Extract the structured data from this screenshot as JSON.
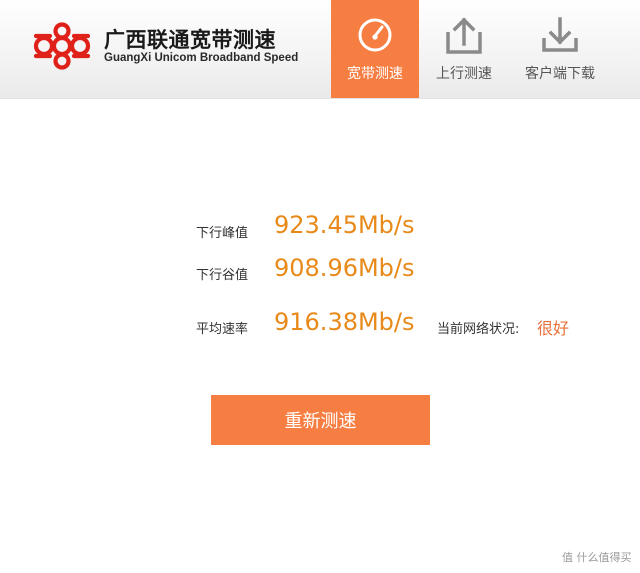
{
  "brand": {
    "name_cn": "广西联通宽带测速",
    "name_en": "GuangXi Unicom Broadband Speed",
    "logo_icon": "china-unicom-knot-icon",
    "logo_color": "#e0211a"
  },
  "nav": {
    "tabs": [
      {
        "label": "宽带测速",
        "icon": "speedometer-icon",
        "active": true
      },
      {
        "label": "上行测速",
        "icon": "upload-icon",
        "active": false
      },
      {
        "label": "客户端下载",
        "icon": "download-icon",
        "active": false
      }
    ],
    "active_color": "#f67e42"
  },
  "results": {
    "peak_label": "下行峰值",
    "peak_value": "923.45Mb/s",
    "valley_label": "下行谷值",
    "valley_value": "908.96Mb/s",
    "avg_label": "平均速率",
    "avg_value": "916.38Mb/s",
    "network_label": "当前网络状况:",
    "network_value": "很好",
    "value_color": "#e88a1a"
  },
  "actions": {
    "retest_label": "重新测速"
  },
  "watermark": "值 什么值得买"
}
